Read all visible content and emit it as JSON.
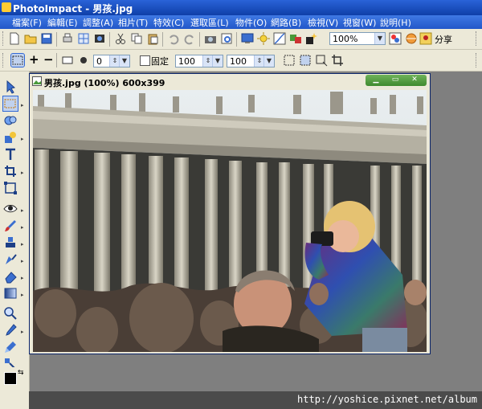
{
  "app": {
    "title": "PhotoImpact - 男孩.jpg"
  },
  "menu": [
    "檔案(F)",
    "編輯(E)",
    "調整(A)",
    "相片(T)",
    "特效(C)",
    "選取區(L)",
    "物件(O)",
    "網路(B)",
    "檢視(V)",
    "視窗(W)",
    "說明(H)"
  ],
  "toolbar1": {
    "zoom_value": "100%",
    "share_label": "分享"
  },
  "toolbar2": {
    "value_a": "0",
    "fixed_label": "固定",
    "width_value": "100",
    "height_value": "100"
  },
  "document": {
    "title": "男孩.jpg (100%) 600x399"
  },
  "watermark": "http://yoshice.pixnet.net/album",
  "colors": {
    "titlebar": "#1f52c4",
    "menubar": "#2c62d4",
    "panel": "#ece9d8",
    "docwin_buttons": "#4f9a3c"
  },
  "icons": {
    "toolbar1": [
      "new-icon",
      "open-icon",
      "save-icon",
      "print-icon",
      "scan-icon",
      "capture-icon",
      "cut-icon",
      "copy-icon",
      "paste-icon",
      "undo-icon",
      "redo-icon",
      "camera-icon",
      "preview-icon",
      "monitor-icon",
      "adjust-icon",
      "curve-icon",
      "filter-icon",
      "effects-icon",
      "layers-icon",
      "share-icon"
    ],
    "tools": [
      "pick-tool-icon",
      "selection-tool-icon",
      "lasso-tool-icon",
      "shape-tool-icon",
      "fill-tool-icon",
      "text-tool-icon",
      "crop-tool-icon",
      "transform-tool-icon",
      "eye-tool-icon",
      "brush-tool-icon",
      "clone-tool-icon",
      "retouch-tool-icon",
      "eraser-tool-icon",
      "gradient-tool-icon",
      "zoom-tool-icon",
      "eyedropper-tool-icon",
      "paint-tool-icon",
      "path-tool-icon"
    ]
  }
}
